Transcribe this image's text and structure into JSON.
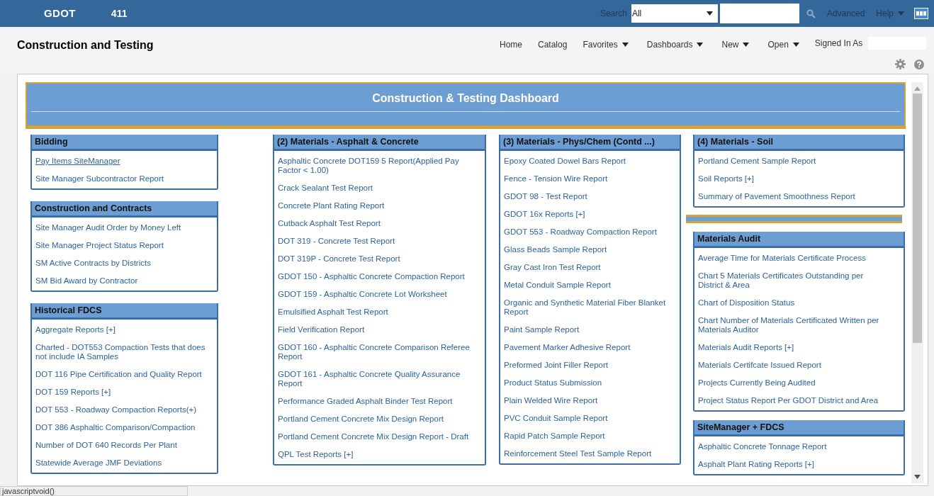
{
  "topbar": {
    "logo": "GDOT",
    "app_number": "411",
    "search_label": "Search",
    "search_scope": "All",
    "links": [
      {
        "label": "Advanced",
        "has_menu": false
      },
      {
        "label": "Help",
        "has_menu": true
      }
    ]
  },
  "header": {
    "title": "Construction and Testing",
    "nav": [
      {
        "label": "Home",
        "has_menu": false
      },
      {
        "label": "Catalog",
        "has_menu": false
      },
      {
        "label": "Favorites",
        "has_menu": true
      },
      {
        "label": "Dashboards",
        "has_menu": true
      },
      {
        "label": "New",
        "has_menu": true
      },
      {
        "label": "Open",
        "has_menu": true
      }
    ],
    "signed_in_label": "Signed In As"
  },
  "dashboard": {
    "title": "Construction & Testing Dashboard",
    "columns": [
      [
        {
          "kind": "panel",
          "title": "Bidding",
          "items": [
            {
              "label": "Pay Items SiteManager",
              "hovered": true
            },
            {
              "label": "Site Manager Subcontractor Report",
              "hovered": false
            }
          ]
        },
        {
          "kind": "panel",
          "title": "Construction and Contracts",
          "items": [
            {
              "label": "Site Manager Audit Order by Money Left",
              "hovered": false
            },
            {
              "label": "Site Manager Project Status Report",
              "hovered": false
            },
            {
              "label": "SM Active Contracts by Districts",
              "hovered": false
            },
            {
              "label": "SM Bid Award by Contractor",
              "hovered": false
            }
          ]
        },
        {
          "kind": "panel",
          "title": "Historical FDCS",
          "items": [
            {
              "label": "Aggregate Reports [+]",
              "hovered": false
            },
            {
              "label": "Charted - DOT553 Compaction Tests that does not include IA Samples",
              "hovered": false
            },
            {
              "label": "DOT 116 Pipe Certification and Quality Report",
              "hovered": false
            },
            {
              "label": "DOT 159 Reports [+]",
              "hovered": false
            },
            {
              "label": "DOT 553 - Roadway Compaction Reports(+)",
              "hovered": false
            },
            {
              "label": "DOT 386 Asphaltic Comparison/Compaction",
              "hovered": false
            },
            {
              "label": "Number of DOT 640 Records Per Plant",
              "hovered": false
            },
            {
              "label": "Statewide Average JMF Deviations",
              "hovered": false
            }
          ]
        }
      ],
      [
        {
          "kind": "panel",
          "title": "(2) Materials - Asphalt & Concrete",
          "items": [
            {
              "label": "Asphaltic Concrete DOT159 5 Report(Applied Pay Factor < 1.00)",
              "hovered": false
            },
            {
              "label": "Crack Sealant Test Report",
              "hovered": false
            },
            {
              "label": "Concrete Plant Rating Report",
              "hovered": false
            },
            {
              "label": "Cutback Asphalt Test Report",
              "hovered": false
            },
            {
              "label": "DOT 319 - Concrete Test Report",
              "hovered": false
            },
            {
              "label": "DOT 319P - Concrete Test Report",
              "hovered": false
            },
            {
              "label": "GDOT 150 - Asphaltic Concrete Compaction Report",
              "hovered": false
            },
            {
              "label": "GDOT 159 - Asphaltic Concrete Lot Worksheet",
              "hovered": false
            },
            {
              "label": "Emulsified Asphalt Test Report",
              "hovered": false
            },
            {
              "label": "Field Verification Report",
              "hovered": false
            },
            {
              "label": "GDOT 160 - Asphaltic Concrete Comparison Referee Report",
              "hovered": false
            },
            {
              "label": "GDOT 161 - Asphaltic Concrete Quality Assurance Report",
              "hovered": false
            },
            {
              "label": "Performance Graded Asphalt Binder Test Report",
              "hovered": false
            },
            {
              "label": "Portland Cement Concrete Mix Design Report",
              "hovered": false
            },
            {
              "label": "Portland Cement Concrete Mix Design Report - Draft",
              "hovered": false
            },
            {
              "label": "QPL Test Reports [+]",
              "hovered": false
            }
          ]
        }
      ],
      [
        {
          "kind": "panel",
          "title": "(3) Materials - Phys/Chem (Contd ...)",
          "items": [
            {
              "label": "Epoxy Coated Dowel Bars Report",
              "hovered": false
            },
            {
              "label": "Fence - Tension Wire Report",
              "hovered": false
            },
            {
              "label": "GDOT 98 - Test Report",
              "hovered": false
            },
            {
              "label": "GDOT 16x Reports [+]",
              "hovered": false
            },
            {
              "label": "GDOT 553 - Roadway Compaction Report",
              "hovered": false
            },
            {
              "label": "Glass Beads Sample Report",
              "hovered": false
            },
            {
              "label": "Gray Cast Iron Test Report",
              "hovered": false
            },
            {
              "label": "Metal Conduit Sample Report",
              "hovered": false
            },
            {
              "label": "Organic and Synthetic Material Fiber Blanket Report",
              "hovered": false
            },
            {
              "label": "Paint Sample Report",
              "hovered": false
            },
            {
              "label": "Pavement Marker Adhesive Report",
              "hovered": false
            },
            {
              "label": "Preformed Joint Filler Report",
              "hovered": false
            },
            {
              "label": "Product Status Submission",
              "hovered": false
            },
            {
              "label": "Plain Welded Wire Report",
              "hovered": false
            },
            {
              "label": "PVC Conduit Sample Report",
              "hovered": false
            },
            {
              "label": "Rapid Patch Sample Report",
              "hovered": false
            },
            {
              "label": "Reinforcement Steel Test Sample Report",
              "hovered": false
            }
          ]
        }
      ],
      [
        {
          "kind": "panel",
          "title": "(4) Materials - Soil",
          "items": [
            {
              "label": "Portland Cement Sample Report",
              "hovered": false
            },
            {
              "label": "Soil Reports [+]",
              "hovered": false
            },
            {
              "label": "Summary of Pavement Smoothness Report",
              "hovered": false
            }
          ]
        },
        {
          "kind": "divider"
        },
        {
          "kind": "panel",
          "title": "Materials Audit",
          "items": [
            {
              "label": "Average Time for Materials Certificate Process",
              "hovered": false
            },
            {
              "label": "Chart 5 Materials Certificates Outstanding per District & Area",
              "hovered": false
            },
            {
              "label": "Chart of Disposition Status",
              "hovered": false
            },
            {
              "label": "Chart Number of Materials Certificated Written per Materials Auditor",
              "hovered": false
            },
            {
              "label": "Materials Audit Reports [+]",
              "hovered": false
            },
            {
              "label": "Materials Certifcate Issued Report",
              "hovered": false
            },
            {
              "label": "Projects Currently Being Audited",
              "hovered": false
            },
            {
              "label": "Project Status Report Per GDOT District and Area",
              "hovered": false
            }
          ]
        },
        {
          "kind": "panel",
          "title": "SiteManager + FDCS",
          "items": [
            {
              "label": "Asphaltic Concrete Tonnage Report",
              "hovered": false
            },
            {
              "label": "Asphalt Plant Rating Reports [+]",
              "hovered": false
            }
          ]
        }
      ]
    ]
  },
  "status_bar": {
    "text": "javascriptvoid()"
  }
}
